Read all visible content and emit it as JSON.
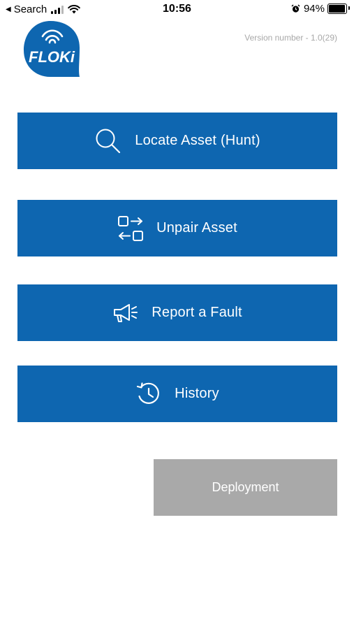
{
  "status_bar": {
    "back_label": "Search",
    "time": "10:56",
    "battery_percent": "94%",
    "battery_level": 0.94
  },
  "header": {
    "logo_text": "FLOKi",
    "version_text": "Version number - 1.0(29)"
  },
  "menu": {
    "locate_label": "Locate Asset (Hunt)",
    "unpair_label": "Unpair Asset",
    "report_label": "Report a Fault",
    "history_label": "History",
    "deployment_label": "Deployment"
  },
  "icons": {
    "locate": "search-icon",
    "unpair": "swap-arrows-icon",
    "report": "megaphone-icon",
    "history": "history-clock-icon"
  },
  "colors": {
    "primary": "#0e66b0",
    "disabled": "#a9a9a9",
    "version_text": "#a8a8a8"
  }
}
